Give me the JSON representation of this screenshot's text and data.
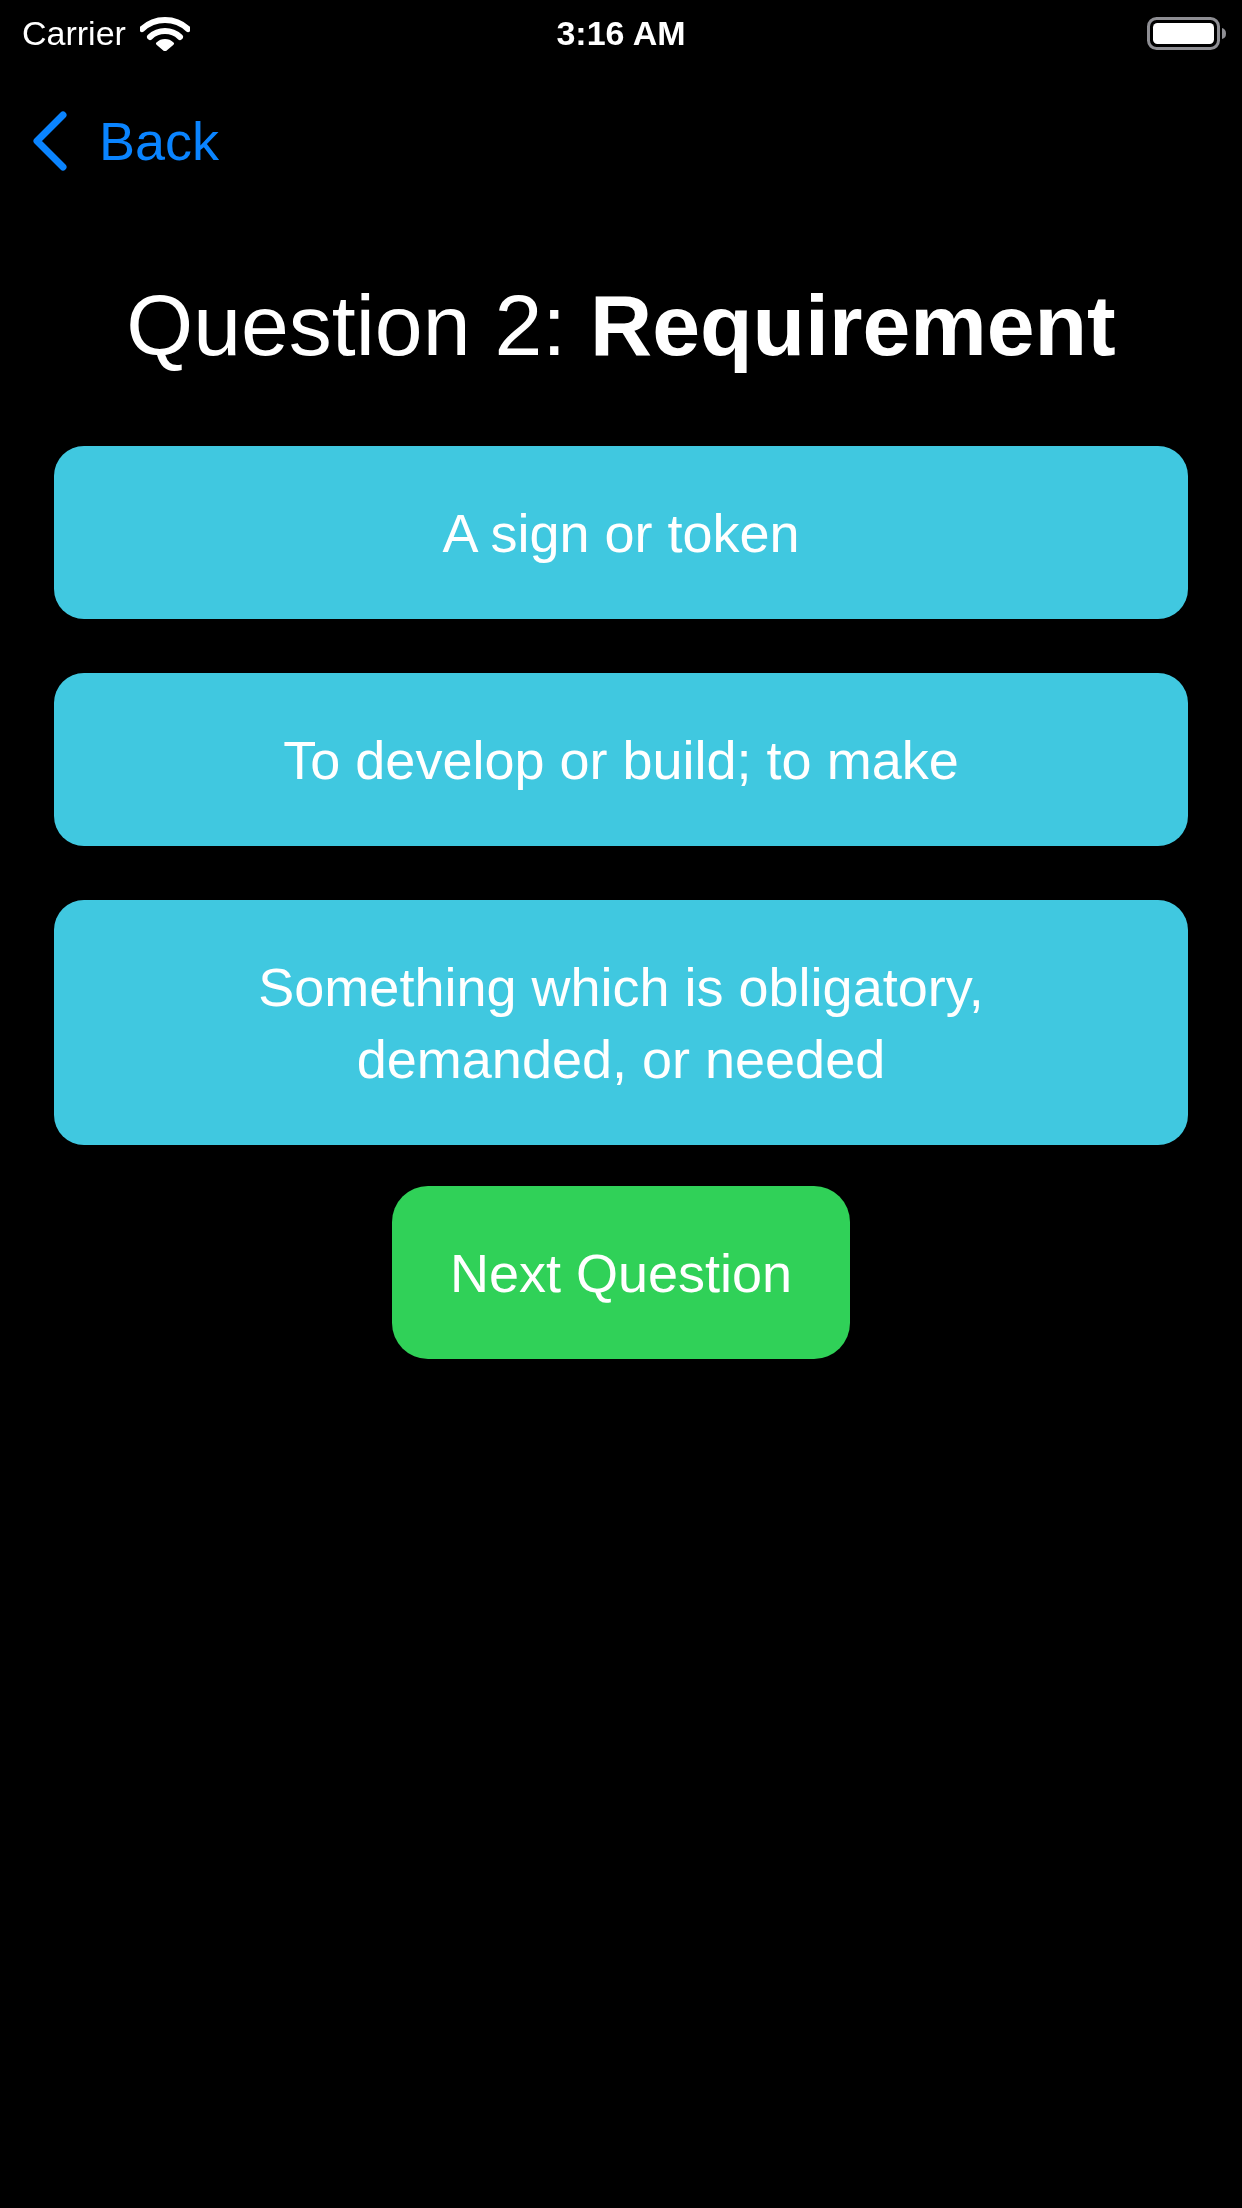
{
  "status_bar": {
    "carrier": "Carrier",
    "time": "3:16 AM"
  },
  "nav": {
    "back": "Back"
  },
  "title": "Question 2: **Requirement**",
  "answers": [
    {
      "label": "A sign or token"
    },
    {
      "label": "To develop or build; to make"
    },
    {
      "label": "Something which is obligatory, demanded, or needed"
    }
  ],
  "next_button": {
    "label": "Next Question"
  }
}
